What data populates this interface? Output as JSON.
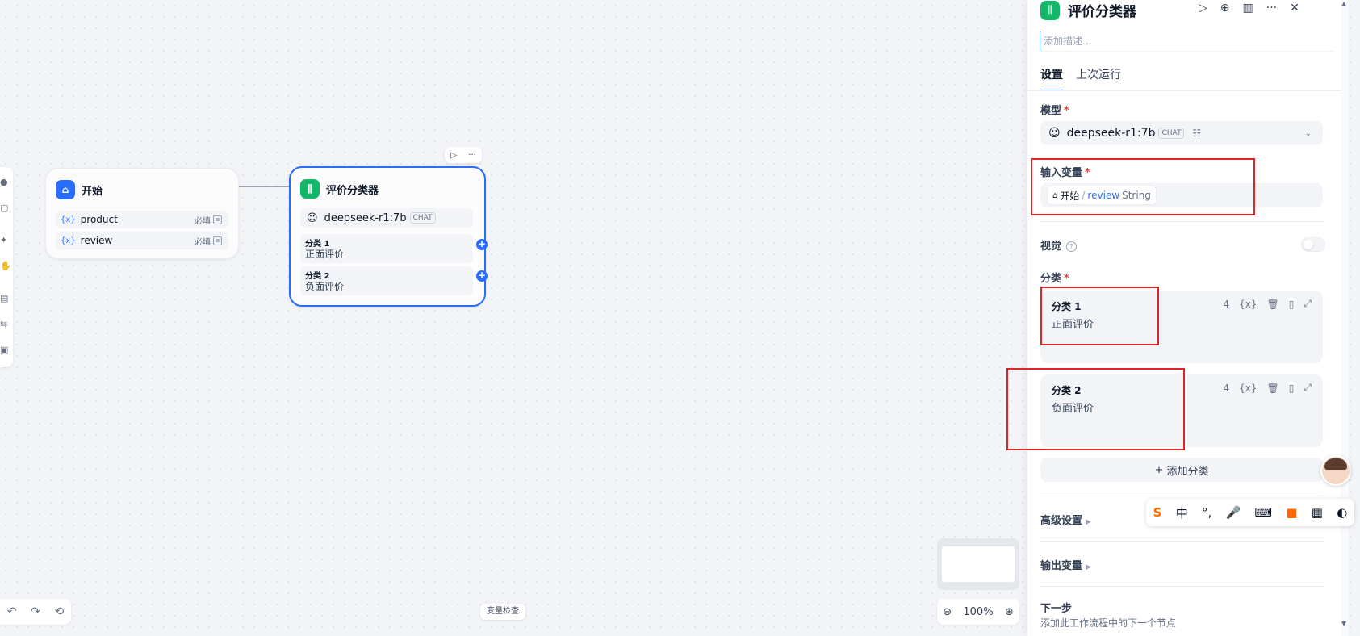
{
  "canvas": {
    "start_node": {
      "title": "开始",
      "variables": [
        {
          "name": "product",
          "required": "必填"
        },
        {
          "name": "review",
          "required": "必填"
        }
      ]
    },
    "classifier_node": {
      "title": "评价分类器",
      "model": "deepseek-r1:7b",
      "model_badge": "CHAT",
      "classes": [
        {
          "title": "分类 1",
          "desc": "正面评价"
        },
        {
          "title": "分类 2",
          "desc": "负面评价"
        }
      ]
    },
    "var_check_label": "变量检查",
    "zoom": "100%"
  },
  "panel": {
    "title": "评价分类器",
    "description_placeholder": "添加描述...",
    "tabs": [
      "设置",
      "上次运行"
    ],
    "model_label": "模型",
    "model_name": "deepseek-r1:7b",
    "model_badge": "CHAT",
    "input_var_label": "输入变量",
    "input_var": {
      "node": "开始",
      "separator": "/",
      "name": "review",
      "type": "String"
    },
    "vision_label": "视觉",
    "classes_label": "分类",
    "classes": [
      {
        "title": "分类 1",
        "desc": "正面评价",
        "count": "4"
      },
      {
        "title": "分类 2",
        "desc": "负面评价",
        "count": "4"
      }
    ],
    "add_class_label": "添加分类",
    "advanced_label": "高级设置",
    "output_label": "输出变量",
    "next_step_label": "下一步",
    "next_step_desc": "添加此工作流程中的下一个节点"
  },
  "ime": {
    "chinese": "中"
  },
  "colors": {
    "primary": "#296dff",
    "green": "#12b76a",
    "highlight": "#e02424"
  }
}
